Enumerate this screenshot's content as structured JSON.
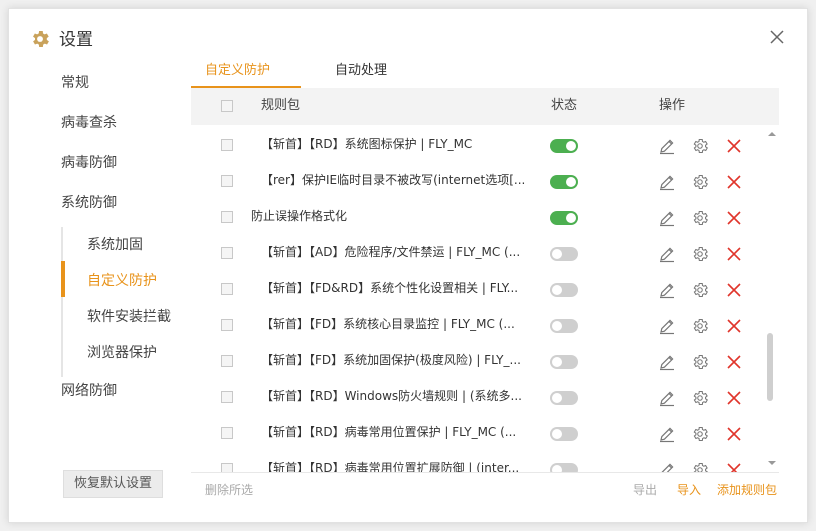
{
  "window": {
    "title": "设置",
    "title_icon": "gear-icon",
    "close_icon": "close-icon"
  },
  "sidebar": {
    "main_items": [
      {
        "label": "常规"
      },
      {
        "label": "病毒查杀"
      },
      {
        "label": "病毒防御"
      },
      {
        "label": "系统防御"
      },
      {
        "label": "网络防御"
      }
    ],
    "sub_items": [
      {
        "label": "系统加固"
      },
      {
        "label": "自定义防护",
        "active": true
      },
      {
        "label": "软件安装拦截"
      },
      {
        "label": "浏览器保护"
      }
    ],
    "restore_button": "恢复默认设置"
  },
  "tabs": [
    {
      "label": "自定义防护",
      "active": true
    },
    {
      "label": "自动处理",
      "active": false
    }
  ],
  "table": {
    "headers": {
      "name": "规则包",
      "status": "状态",
      "actions": "操作"
    },
    "rows": [
      {
        "name": "【斩首】【RD】系统图标保护 | FLY_MC",
        "enabled": true
      },
      {
        "name": "【rer】保护IE临时目录不被改写(internet选项[...",
        "enabled": true
      },
      {
        "name": "防止误操作格式化",
        "enabled": true
      },
      {
        "name": "【斩首】【AD】危险程序/文件禁运 | FLY_MC (...",
        "enabled": false
      },
      {
        "name": "【斩首】【FD&RD】系统个性化设置相关 | FLY...",
        "enabled": false
      },
      {
        "name": "【斩首】【FD】系统核心目录监控 | FLY_MC (...",
        "enabled": false
      },
      {
        "name": "【斩首】【FD】系统加固保护(极度风险) | FLY_...",
        "enabled": false
      },
      {
        "name": "【斩首】【RD】Windows防火墙规则 | (系统多...",
        "enabled": false
      },
      {
        "name": "【斩首】【RD】病毒常用位置保护 | FLY_MC (...",
        "enabled": false
      },
      {
        "name": "【斩首】【RD】病毒常用位置扩展防御 | (inter...",
        "enabled": false
      }
    ]
  },
  "footer": {
    "delete_selected": "删除所选",
    "export": "导出",
    "import": "导入",
    "add_rule_pack": "添加规则包"
  },
  "colors": {
    "accent": "#e8931b",
    "toggle_on": "#4caf50",
    "toggle_off": "#cfcfcf",
    "delete_icon": "#e0352b"
  }
}
